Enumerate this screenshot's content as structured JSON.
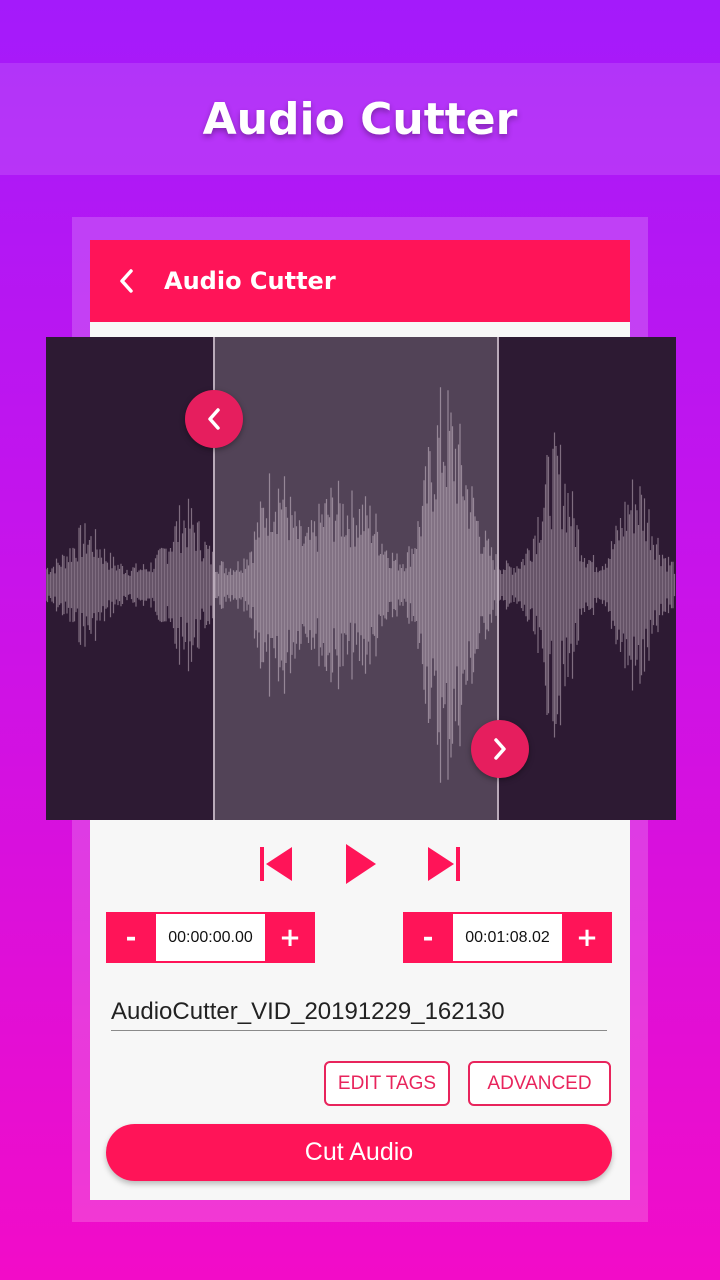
{
  "banner": {
    "title": "Audio Cutter"
  },
  "appbar": {
    "title": "Audio Cutter",
    "back_icon": "chevron-left-icon"
  },
  "waveform": {
    "background_color": "#2d1a33",
    "selection_color": "rgba(255,255,255,0.18)",
    "handle_color": "#e61e5e",
    "start_handle_icon": "chevron-left-icon",
    "end_handle_icon": "chevron-right-icon"
  },
  "playback": {
    "prev_icon": "skip-previous-icon",
    "play_icon": "play-icon",
    "next_icon": "skip-next-icon",
    "accent_color": "#ff1458"
  },
  "start_time": {
    "minus_label": "-",
    "value": "00:00:00.00",
    "plus_label": "+"
  },
  "end_time": {
    "minus_label": "-",
    "value": "00:01:08.02",
    "plus_label": "+"
  },
  "filename": {
    "value": "AudioCutter_VID_20191229_162130"
  },
  "buttons": {
    "edit_tags": "EDIT TAGS",
    "advanced": "ADVANCED",
    "cut_audio": "Cut Audio"
  }
}
